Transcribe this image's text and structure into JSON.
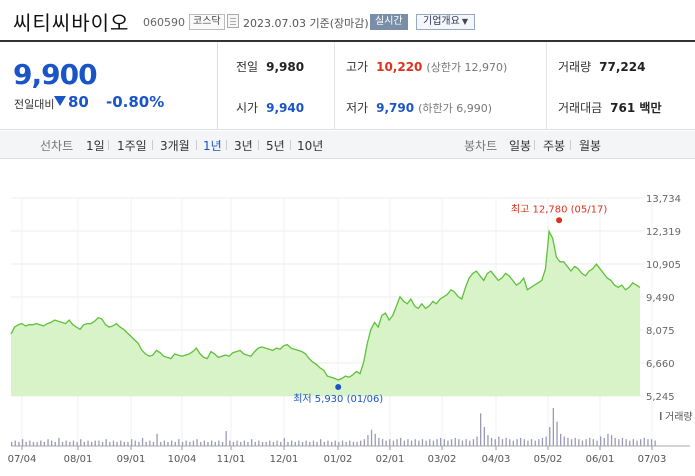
{
  "header": {
    "stock_name": "씨티씨바이오",
    "stock_code": "060590",
    "market": "코스닥",
    "date_text": "2023.07.03 기준(장마감)",
    "realtime_label": "실시간",
    "company_label": "기업개요"
  },
  "price": {
    "current": "9,900",
    "change_label": "전일대비",
    "change_value": "80",
    "change_pct": "-0.80%"
  },
  "stats": {
    "prev_label": "전일",
    "prev_value": "9,980",
    "high_label": "고가",
    "high_value": "10,220",
    "upper_limit": "(상한가 12,970)",
    "volume_label": "거래량",
    "volume_value": "77,224",
    "open_label": "시가",
    "open_value": "9,940",
    "low_label": "저가",
    "low_value": "9,790",
    "lower_limit": "(하한가 6,990)",
    "amount_label": "거래대금",
    "amount_value": "761 백만"
  },
  "tabs": {
    "line_label": "선차트",
    "line_items": [
      "1일",
      "1주일",
      "3개월",
      "1년",
      "3년",
      "5년",
      "10년"
    ],
    "active_index": 3,
    "candle_label": "봉차트",
    "candle_items": [
      "일봉",
      "주봉",
      "월봉"
    ]
  },
  "colors": {
    "up": "#e0301e",
    "down": "#1a55c8",
    "line": "#5ec23a",
    "fill": "#d6f2c4"
  },
  "chart_data": {
    "type": "area",
    "y_ticks": [
      "13,734",
      "12,319",
      "10,905",
      "9,490",
      "8,075",
      "6,660",
      "5,245"
    ],
    "ylim": [
      5245,
      13734
    ],
    "x_ticks": [
      "07/04",
      "08/01",
      "09/01",
      "10/04",
      "11/01",
      "12/01",
      "01/02",
      "02/01",
      "03/02",
      "04/03",
      "05/02",
      "06/01",
      "07/03"
    ],
    "high_annotation": "최고 12,780 (05/17)",
    "low_annotation": "최저 5,930 (01/06)",
    "volume_label": "거래량",
    "series": [
      {
        "values": [
          7900,
          8200,
          8300,
          8350,
          8250,
          8300,
          8300,
          8350,
          8300,
          8250,
          8350,
          8400,
          8500,
          8450,
          8400,
          8350,
          8500,
          8300,
          8200,
          8100,
          8300,
          8350,
          8350,
          8450,
          8600,
          8550,
          8300,
          8200,
          8250,
          8350,
          8200,
          8100,
          7950,
          7800,
          7650,
          7500,
          7200,
          7050,
          6950,
          7000,
          7200,
          7100,
          6950,
          6900,
          6850,
          7050,
          7000,
          6950,
          7000,
          7050,
          7150,
          7300,
          7050,
          6900,
          6850,
          7150,
          7050,
          6900,
          6950,
          7000,
          6950,
          7100,
          7150,
          7200,
          7050,
          7000,
          6950,
          7150,
          7300,
          7350,
          7300,
          7250,
          7200,
          7300,
          7250,
          7400,
          7450,
          7300,
          7250,
          7200,
          7150,
          7050,
          6850,
          6700,
          6600,
          6450,
          6350,
          6100,
          6050,
          6000,
          5930,
          6000,
          6100,
          6050,
          6150,
          6300,
          6200,
          6700,
          7500,
          8100,
          8400,
          8200,
          8700,
          8800,
          8500,
          8700,
          9100,
          9500,
          9300,
          9200,
          9400,
          9100,
          9000,
          9200,
          9000,
          9100,
          9300,
          9200,
          9400,
          9500,
          9600,
          9800,
          9700,
          9500,
          9400,
          9900,
          10300,
          10500,
          10600,
          10400,
          10200,
          10500,
          10600,
          10400,
          10200,
          10300,
          10500,
          10400,
          10200,
          10000,
          10100,
          10300,
          9800,
          9900,
          10000,
          10100,
          10200,
          10700,
          12300,
          12000,
          11200,
          11000,
          11000,
          10800,
          10600,
          10800,
          10700,
          10500,
          10400,
          10600,
          10700,
          10900,
          10700,
          10500,
          10300,
          10200,
          10000,
          9900,
          10000,
          9800,
          9900,
          10100,
          10000,
          9900
        ],
        "volume_bars": [
          3,
          4,
          3,
          5,
          3,
          4,
          3,
          3,
          4,
          3,
          5,
          4,
          3,
          6,
          3,
          4,
          3,
          4,
          3,
          5,
          3,
          4,
          3,
          4,
          4,
          3,
          5,
          3,
          4,
          3,
          4,
          3,
          3,
          5,
          4,
          3,
          6,
          3,
          4,
          3,
          9,
          3,
          4,
          3,
          4,
          3,
          5,
          3,
          4,
          3,
          4,
          5,
          3,
          4,
          3,
          4,
          3,
          4,
          3,
          11,
          4,
          3,
          4,
          3,
          4,
          3,
          5,
          3,
          4,
          3,
          3,
          4,
          3,
          4,
          3,
          6,
          3,
          4,
          3,
          4,
          3,
          4,
          3,
          4,
          3,
          5,
          3,
          4,
          3,
          4,
          3,
          4,
          3,
          4,
          3,
          3,
          4,
          5,
          8,
          12,
          9,
          6,
          5,
          4,
          5,
          4,
          5,
          6,
          4,
          5,
          4,
          5,
          4,
          5,
          4,
          5,
          4,
          5,
          6,
          5,
          4,
          5,
          6,
          5,
          4,
          5,
          4,
          5,
          7,
          24,
          14,
          8,
          6,
          5,
          7,
          5,
          6,
          5,
          4,
          5,
          6,
          5,
          4,
          5,
          4,
          5,
          6,
          7,
          14,
          28,
          18,
          9,
          7,
          6,
          5,
          6,
          5,
          4,
          5,
          6,
          5,
          4,
          7,
          6,
          9,
          8,
          6,
          5,
          6,
          5,
          4,
          5,
          4,
          5,
          6,
          5,
          5,
          4
        ]
      }
    ]
  }
}
